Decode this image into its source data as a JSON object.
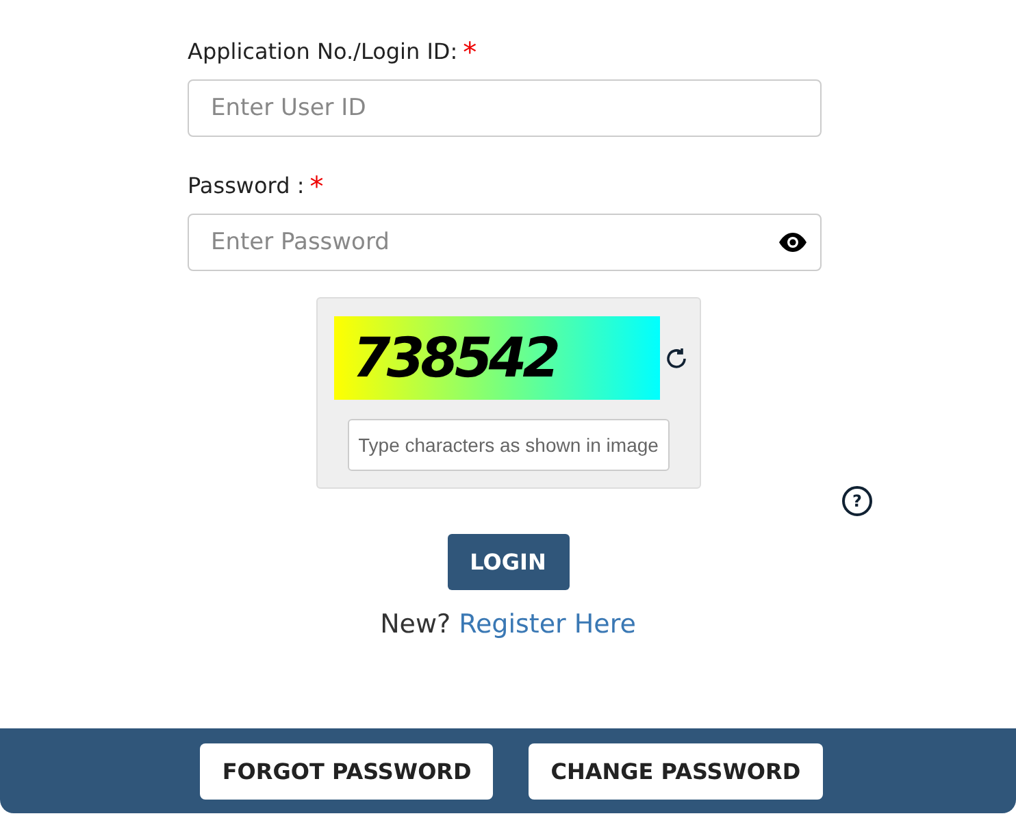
{
  "fields": [
    {
      "label": "Application No./Login ID:",
      "required_mark": "*",
      "placeholder": "Enter User ID",
      "kind": "text"
    },
    {
      "label": "Password :",
      "required_mark": "*",
      "placeholder": "Enter Password",
      "kind": "password"
    }
  ],
  "captcha": {
    "code": "738542",
    "placeholder": "Type characters as shown in image",
    "help": "?"
  },
  "login_button": "LOGIN",
  "register": {
    "prefix": "New?",
    "link": "Register Here"
  },
  "footer_buttons": [
    "FORGOT PASSWORD",
    "CHANGE PASSWORD"
  ]
}
